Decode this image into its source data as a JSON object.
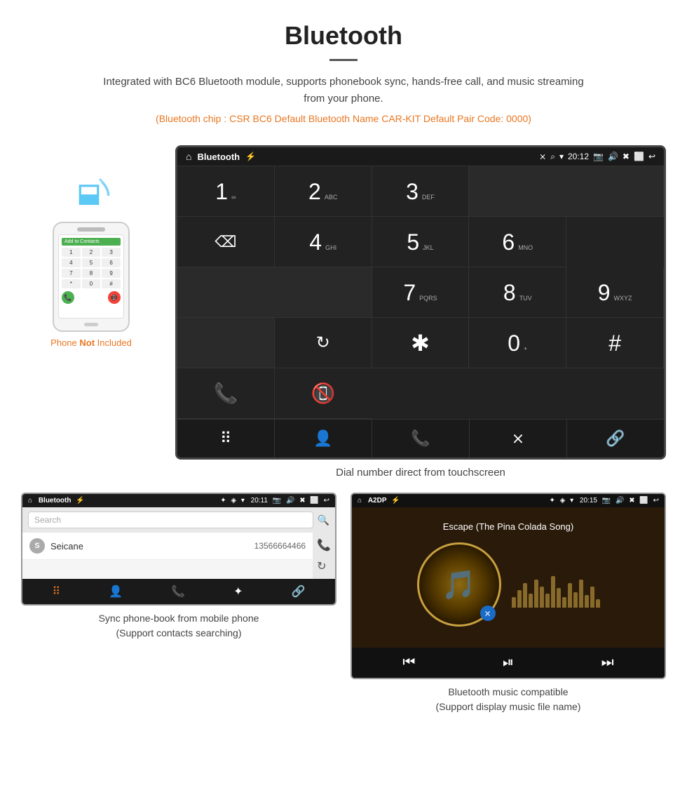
{
  "page": {
    "title": "Bluetooth"
  },
  "header": {
    "title": "Bluetooth",
    "description": "Integrated with BC6 Bluetooth module, supports phonebook sync, hands-free call, and music streaming from your phone.",
    "specs": "(Bluetooth chip : CSR BC6   Default Bluetooth Name CAR-KIT    Default Pair Code: 0000)"
  },
  "phone_label": "Phone Not Included",
  "phone_not_label_not": "Not",
  "main_dial_caption": "Dial number direct from touchscreen",
  "dial_screen": {
    "status_title": "Bluetooth",
    "status_time": "20:12",
    "keys": [
      {
        "num": "1",
        "sub": ""
      },
      {
        "num": "2",
        "sub": "ABC"
      },
      {
        "num": "3",
        "sub": "DEF"
      },
      {
        "num": "4",
        "sub": "GHI"
      },
      {
        "num": "5",
        "sub": "JKL"
      },
      {
        "num": "6",
        "sub": "MNO"
      },
      {
        "num": "7",
        "sub": "PQRS"
      },
      {
        "num": "8",
        "sub": "TUV"
      },
      {
        "num": "9",
        "sub": "WXYZ"
      },
      {
        "num": "*",
        "sub": ""
      },
      {
        "num": "0",
        "sub": "+"
      },
      {
        "num": "#",
        "sub": ""
      }
    ]
  },
  "phonebook_screen": {
    "status_title": "Bluetooth",
    "status_time": "20:11",
    "search_placeholder": "Search",
    "contact_initial": "S",
    "contact_name": "Seicane",
    "contact_phone": "13566664466",
    "caption": "Sync phone-book from mobile phone",
    "caption2": "(Support contacts searching)"
  },
  "music_screen": {
    "status_title": "A2DP",
    "status_time": "20:15",
    "song_title": "Escape (The Pina Colada Song)",
    "caption": "Bluetooth music compatible",
    "caption2": "(Support display music file name)"
  },
  "colors": {
    "accent_orange": "#e87722",
    "screen_bg": "#222222",
    "status_bg": "#1a1a1a"
  }
}
